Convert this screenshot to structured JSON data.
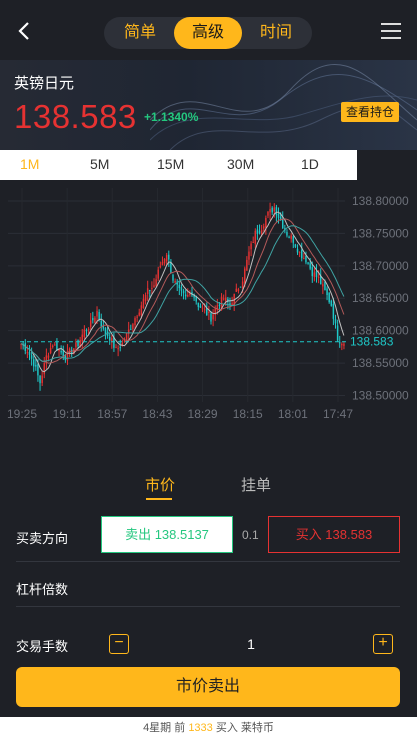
{
  "header": {
    "tabs": [
      "简单",
      "高级",
      "时间"
    ],
    "active_tab": 1
  },
  "quote": {
    "name": "英镑日元",
    "price": "138.583",
    "change": "+1.1340%",
    "positions_button": "查看持仓"
  },
  "timeframes": {
    "items": [
      "1M",
      "5M",
      "15M",
      "30M",
      "1D"
    ],
    "active": 0
  },
  "chart_data": {
    "type": "candlestick",
    "y_ticks": [
      "138.80000",
      "138.75000",
      "138.70000",
      "138.65000",
      "138.60000",
      "138.55000",
      "138.50000"
    ],
    "ylim": [
      138.49,
      138.82
    ],
    "x_ticks": [
      "19:25",
      "19:11",
      "18:57",
      "18:43",
      "18:29",
      "18:15",
      "18:01",
      "17:47"
    ],
    "current_price": 138.583,
    "current_label": "138.583",
    "closes": [
      138.58,
      138.57,
      138.55,
      138.52,
      138.56,
      138.58,
      138.57,
      138.56,
      138.57,
      138.58,
      138.6,
      138.61,
      138.63,
      138.6,
      138.59,
      138.57,
      138.58,
      138.6,
      138.62,
      138.64,
      138.66,
      138.67,
      138.7,
      138.72,
      138.68,
      138.66,
      138.65,
      138.66,
      138.64,
      138.63,
      138.62,
      138.64,
      138.65,
      138.64,
      138.66,
      138.68,
      138.72,
      138.75,
      138.76,
      138.78,
      138.79,
      138.77,
      138.75,
      138.74,
      138.72,
      138.71,
      138.69,
      138.68,
      138.66,
      138.64,
      138.59,
      138.58
    ],
    "colors": {
      "up": "#e63232",
      "down": "#1ec8c8",
      "ma1": "#c0c0c0",
      "ma2": "#b35a5a",
      "ma3": "#3fa3a3"
    }
  },
  "order": {
    "tabs": [
      "市价",
      "挂单"
    ],
    "active_tab": 0,
    "direction_label": "买卖方向",
    "sell": "卖出 138.5137",
    "spread": "0.1",
    "buy": "买入 138.583",
    "leverage_label": "杠杆倍数",
    "lots_label": "交易手数",
    "minus": "−",
    "plus": "+",
    "quantity": "1",
    "submit": "市价卖出"
  },
  "footer": {
    "pre": "4星期 前",
    "count": "1333",
    "post": "买入 莱特币"
  }
}
